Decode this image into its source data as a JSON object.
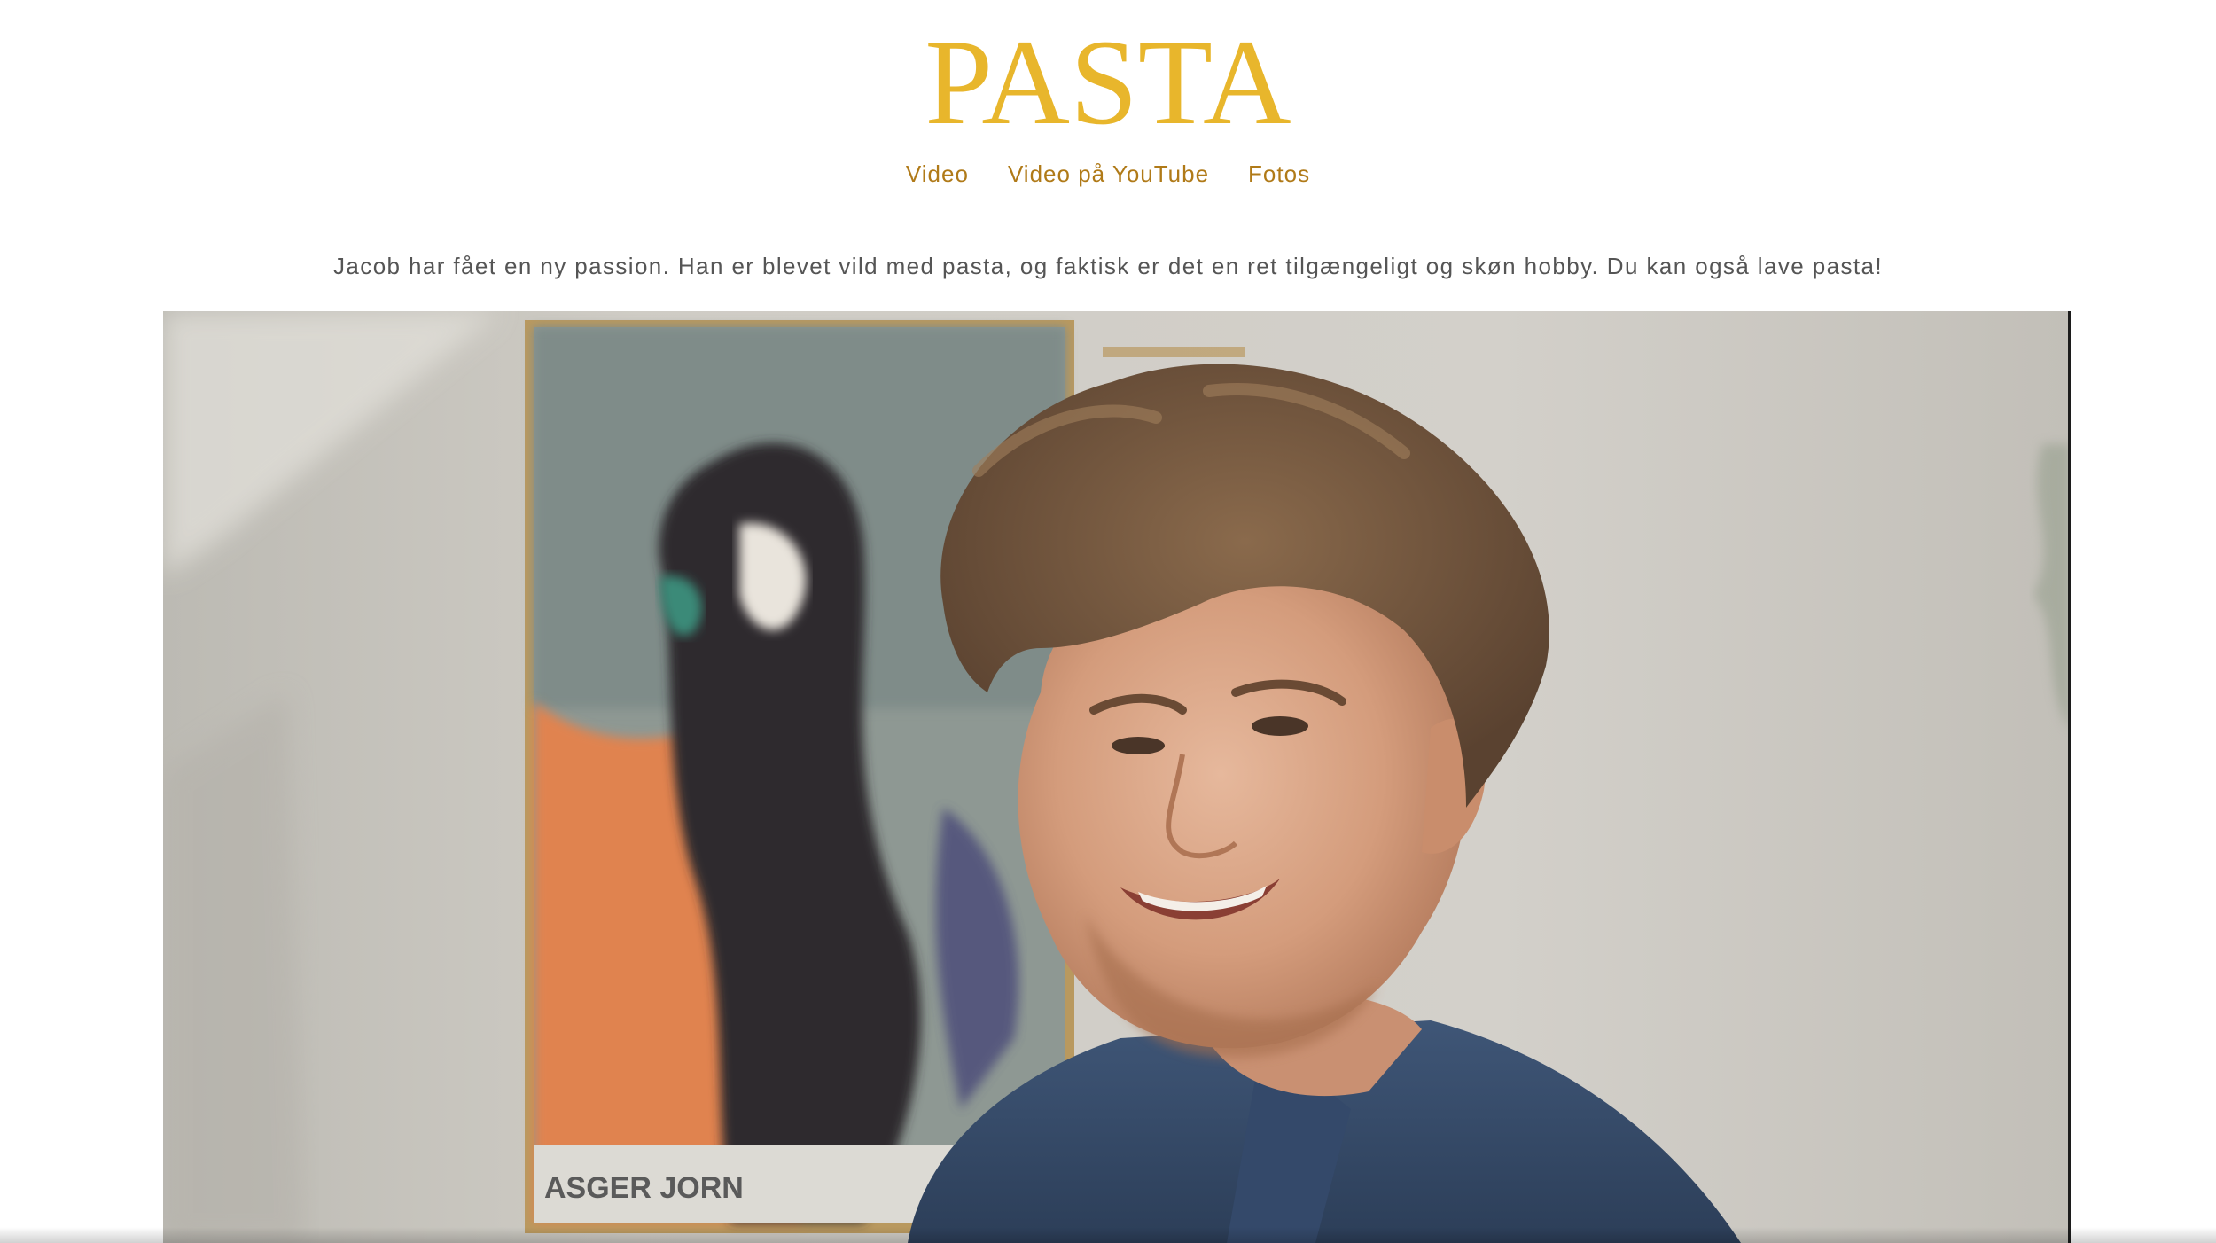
{
  "site": {
    "title": "PASTA"
  },
  "nav": {
    "items": [
      {
        "label": "Video"
      },
      {
        "label": "Video på YouTube"
      },
      {
        "label": "Fotos"
      }
    ]
  },
  "intro": {
    "text": "Jacob har fået en ny passion. Han er blevet vild med pasta, og faktisk er det en ret tilgængeligt og skøn hobby. Du kan også lave pasta!"
  },
  "video": {
    "poster_caption": "ASGER JORN"
  },
  "colors": {
    "title": "#e8b62c",
    "nav_link": "#b07a18",
    "body_text": "#555555"
  }
}
